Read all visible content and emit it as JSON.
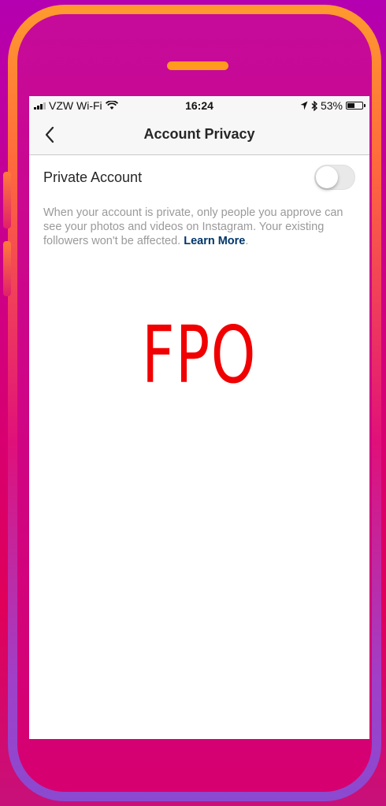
{
  "status_bar": {
    "carrier": "VZW Wi-Fi",
    "time": "16:24",
    "battery": "53%",
    "battery_level": 0.53
  },
  "nav": {
    "title": "Account Privacy",
    "back_icon": "chevron-left-icon"
  },
  "private_account": {
    "label": "Private Account",
    "enabled": false
  },
  "help": {
    "text": "When your account is private, only people you approve can see your photos and videos on Instagram. Your existing followers won't be affected. ",
    "link": "Learn More",
    "suffix": "."
  },
  "placeholder_text": "FPO",
  "colors": {
    "link": "#003569",
    "placeholder": "#f00000",
    "speaker": "#ff9a1e"
  }
}
